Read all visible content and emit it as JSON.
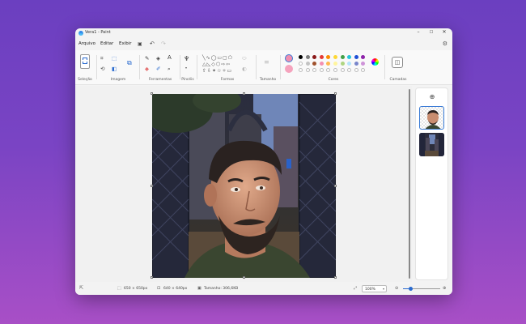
{
  "window": {
    "title": "Vera1 - Paint"
  },
  "menu": {
    "items": [
      "Arquivo",
      "Editar",
      "Exibir"
    ]
  },
  "ribbon": {
    "groups": {
      "selection": "Seleção",
      "image": "Imagem",
      "tools": "Ferramentas",
      "brushes": "Pincéis",
      "shapes": "Formas",
      "size": "Tamanho",
      "colors": "Cores",
      "layers": "Camadas"
    },
    "colors": {
      "primary": "#f08fb0",
      "secondary": "#f5a3bd",
      "row1": [
        "#000000",
        "#7f7f7f",
        "#8b1a1a",
        "#e53935",
        "#fb8c00",
        "#fdd835",
        "#43a047",
        "#26c6da",
        "#1e4fd6",
        "#8e24aa"
      ],
      "row2": [
        "#ffffff",
        "#c3c3c3",
        "#a0522d",
        "#f48fb1",
        "#ffb74d",
        "#fff59d",
        "#aed581",
        "#b3e5fc",
        "#7986cb",
        "#ce93d8"
      ]
    }
  },
  "status": {
    "selection_size": "650 × 650px",
    "image_size": "640 × 640px",
    "file_size": "Tamanho: 306,6KB",
    "zoom": "100%",
    "zoom_level": 0.2
  }
}
